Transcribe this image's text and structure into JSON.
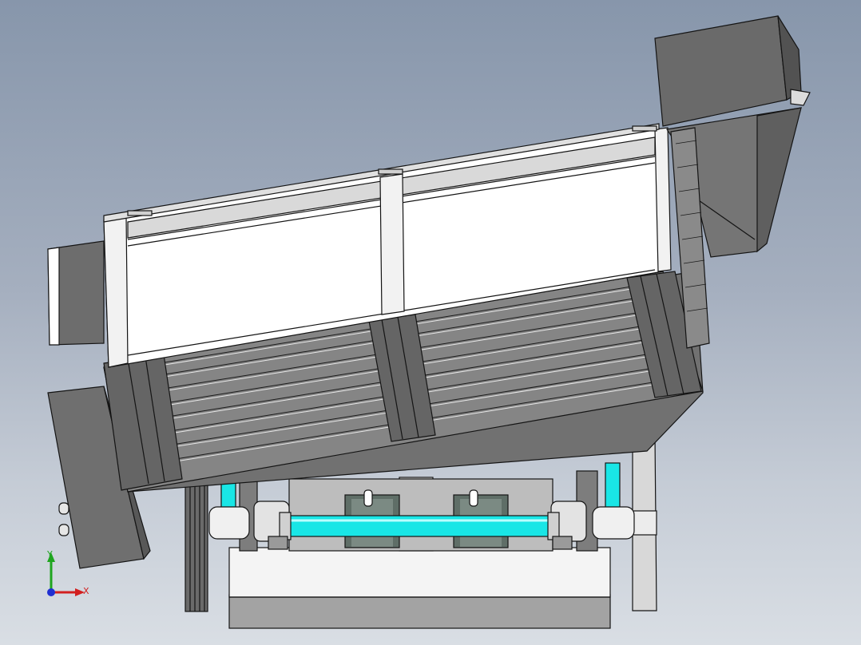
{
  "triad": {
    "x_label": "X",
    "y_label": "Y",
    "colors": {
      "x": "#d21f1f",
      "y": "#1fa51f",
      "z": "#1f2fd2"
    }
  },
  "colors": {
    "body_dark": "#6f6f6f",
    "body_mid": "#8a8a8a",
    "panel_white": "#ffffff",
    "shaft_cyan": "#19e6e6",
    "edge": "#141414"
  }
}
